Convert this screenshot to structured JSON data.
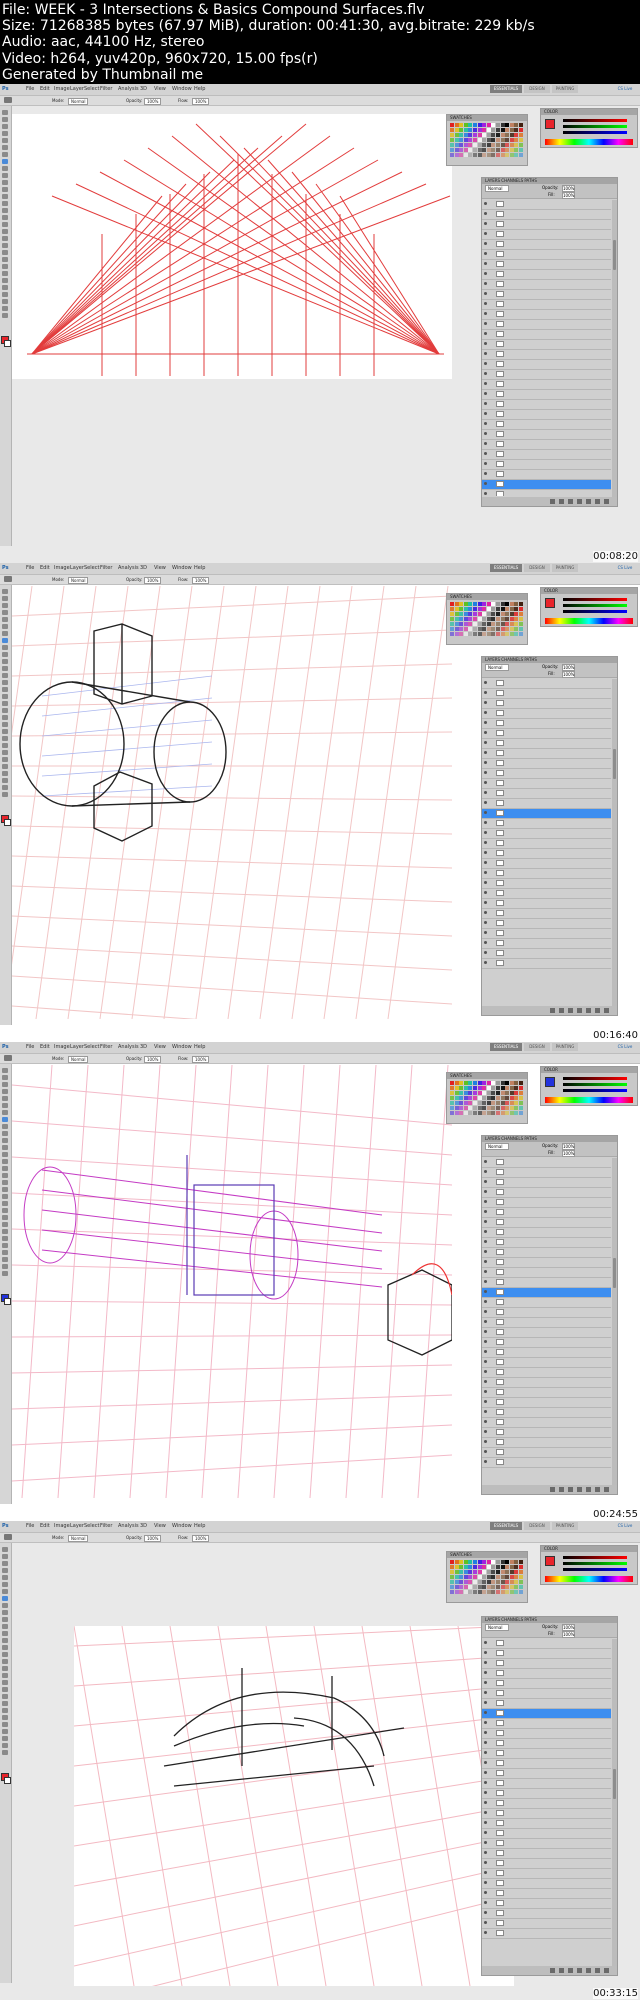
{
  "header": {
    "lines": [
      "File: WEEK - 3 Intersections & Basics Compound Surfaces.flv",
      "Size: 71268385 bytes (67.97 MiB), duration: 00:41:30, avg.bitrate: 229 kb/s",
      "Audio: aac, 44100 Hz, stereo",
      "Video: h264, yuv420p, 960x720, 15.00 fps(r)",
      "Generated by Thumbnail me"
    ]
  },
  "menu_items": [
    "File",
    "Edit",
    "Image",
    "Layer",
    "Select",
    "Filter",
    "Analysis",
    "3D",
    "View",
    "Window",
    "Help"
  ],
  "options_bar": {
    "mode_label": "Mode:",
    "mode_value": "Normal",
    "opacity_label": "Opacity:",
    "opacity_value": "100%",
    "flow_label": "Flow:",
    "flow_value": "100%"
  },
  "workspace_buttons": [
    "ESSENTIALS",
    "DESIGN",
    "PAINTING"
  ],
  "cs_live": "CS Live",
  "panel_labels": {
    "swatches": "SWATCHES",
    "color": "COLOR",
    "layers_tabs": "LAYERS  CHANNELS  PATHS",
    "blend_mode": "Normal",
    "opacity": "Opacity:",
    "opacity_val": "100%",
    "fill": "Fill:",
    "fill_val": "100%"
  },
  "colors": {
    "accent": "#3d8ef0",
    "brush_red": "#e8242b",
    "workspace_btn": "#8c8c8c"
  },
  "frames": [
    {
      "timestamp": "00:08:20",
      "layers": [
        "",
        "",
        "",
        "",
        "",
        "",
        "",
        "",
        "",
        "",
        "",
        "",
        "",
        "",
        "",
        "",
        "",
        "",
        "",
        "",
        "",
        "",
        "",
        "",
        "",
        "",
        "",
        "",
        "",
        "",
        ""
      ],
      "selected": 28
    },
    {
      "timestamp": "00:16:40",
      "layers": [
        "",
        "",
        "",
        "",
        "",
        "",
        "",
        "",
        "",
        "",
        "",
        "",
        "",
        "",
        "",
        "",
        "",
        "",
        "",
        "",
        "",
        "",
        "",
        "",
        "",
        "",
        "",
        "",
        ""
      ],
      "selected": 13
    },
    {
      "timestamp": "00:24:55",
      "layers": [
        "",
        "",
        "",
        "",
        "",
        "",
        "",
        "",
        "",
        "",
        "",
        "",
        "",
        "",
        "",
        "",
        "",
        "",
        "",
        "",
        "",
        "",
        "",
        "",
        "",
        "",
        "",
        "",
        "",
        "",
        ""
      ],
      "selected": 13
    },
    {
      "timestamp": "00:33:15",
      "layers": [
        "",
        "",
        "",
        "",
        "",
        "",
        "",
        "",
        "",
        "",
        "",
        "",
        "",
        "",
        "",
        "",
        "",
        "",
        "",
        "",
        "",
        "",
        "",
        "",
        "",
        "",
        "",
        "",
        "",
        ""
      ],
      "selected": 7
    }
  ]
}
